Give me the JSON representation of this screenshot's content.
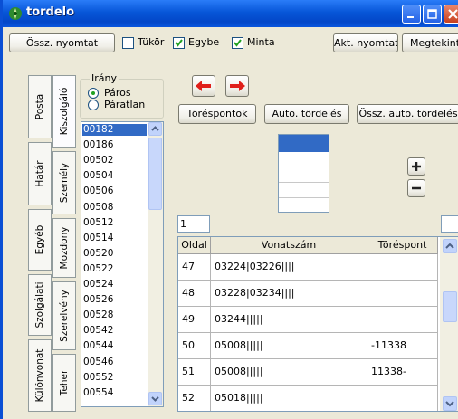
{
  "window": {
    "title": "tordelo"
  },
  "toolbar": {
    "print_all_label": "Össz. nyomtat",
    "mirror_label": "Tükör",
    "mirror_checked": false,
    "together_label": "Egybe",
    "together_checked": true,
    "sample_label": "Minta",
    "sample_checked": true,
    "print_current_label": "Akt. nyomtat",
    "view_label": "Megtekint"
  },
  "left_tabs": {
    "outer": [
      "Posta",
      "Határ",
      "Egyéb",
      "Szolgálati",
      "Különvonat"
    ],
    "inner": [
      "Kiszolgáló",
      "Személy",
      "Mozdony",
      "Szerelvény",
      "Teher"
    ]
  },
  "direction": {
    "label": "Irány",
    "options": [
      "Páros",
      "Páratlan"
    ],
    "selected": "Páros"
  },
  "train_list": {
    "items": [
      "00182",
      "00186",
      "00502",
      "00504",
      "00506",
      "00508",
      "00512",
      "00514",
      "00520",
      "00522",
      "00524",
      "00526",
      "00528",
      "00542",
      "00544",
      "00546",
      "00552",
      "00554"
    ],
    "selected": "00182"
  },
  "actions": {
    "breakpoints_label": "Töréspontok",
    "auto_break_label": "Auto. tördelés",
    "all_auto_break_label": "Össz. auto. tördelés"
  },
  "fields": {
    "left_value": "1",
    "right_value": ""
  },
  "grid": {
    "columns": [
      "Oldal",
      "Vonatszám",
      "Töréspont"
    ],
    "rows": [
      {
        "page": "47",
        "trains": "03224|03226||||",
        "break": ""
      },
      {
        "page": "48",
        "trains": "03228|03234||||",
        "break": ""
      },
      {
        "page": "49",
        "trains": "03244|||||",
        "break": ""
      },
      {
        "page": "50",
        "trains": "05008|||||",
        "break": "-11338"
      },
      {
        "page": "51",
        "trains": "05008|||||",
        "break": "11338-"
      },
      {
        "page": "52",
        "trains": "05018|||||",
        "break": ""
      }
    ]
  },
  "colors": {
    "accent": "#316ac5",
    "arrow": "#e0201b",
    "titlebar": "#0a56dd"
  }
}
